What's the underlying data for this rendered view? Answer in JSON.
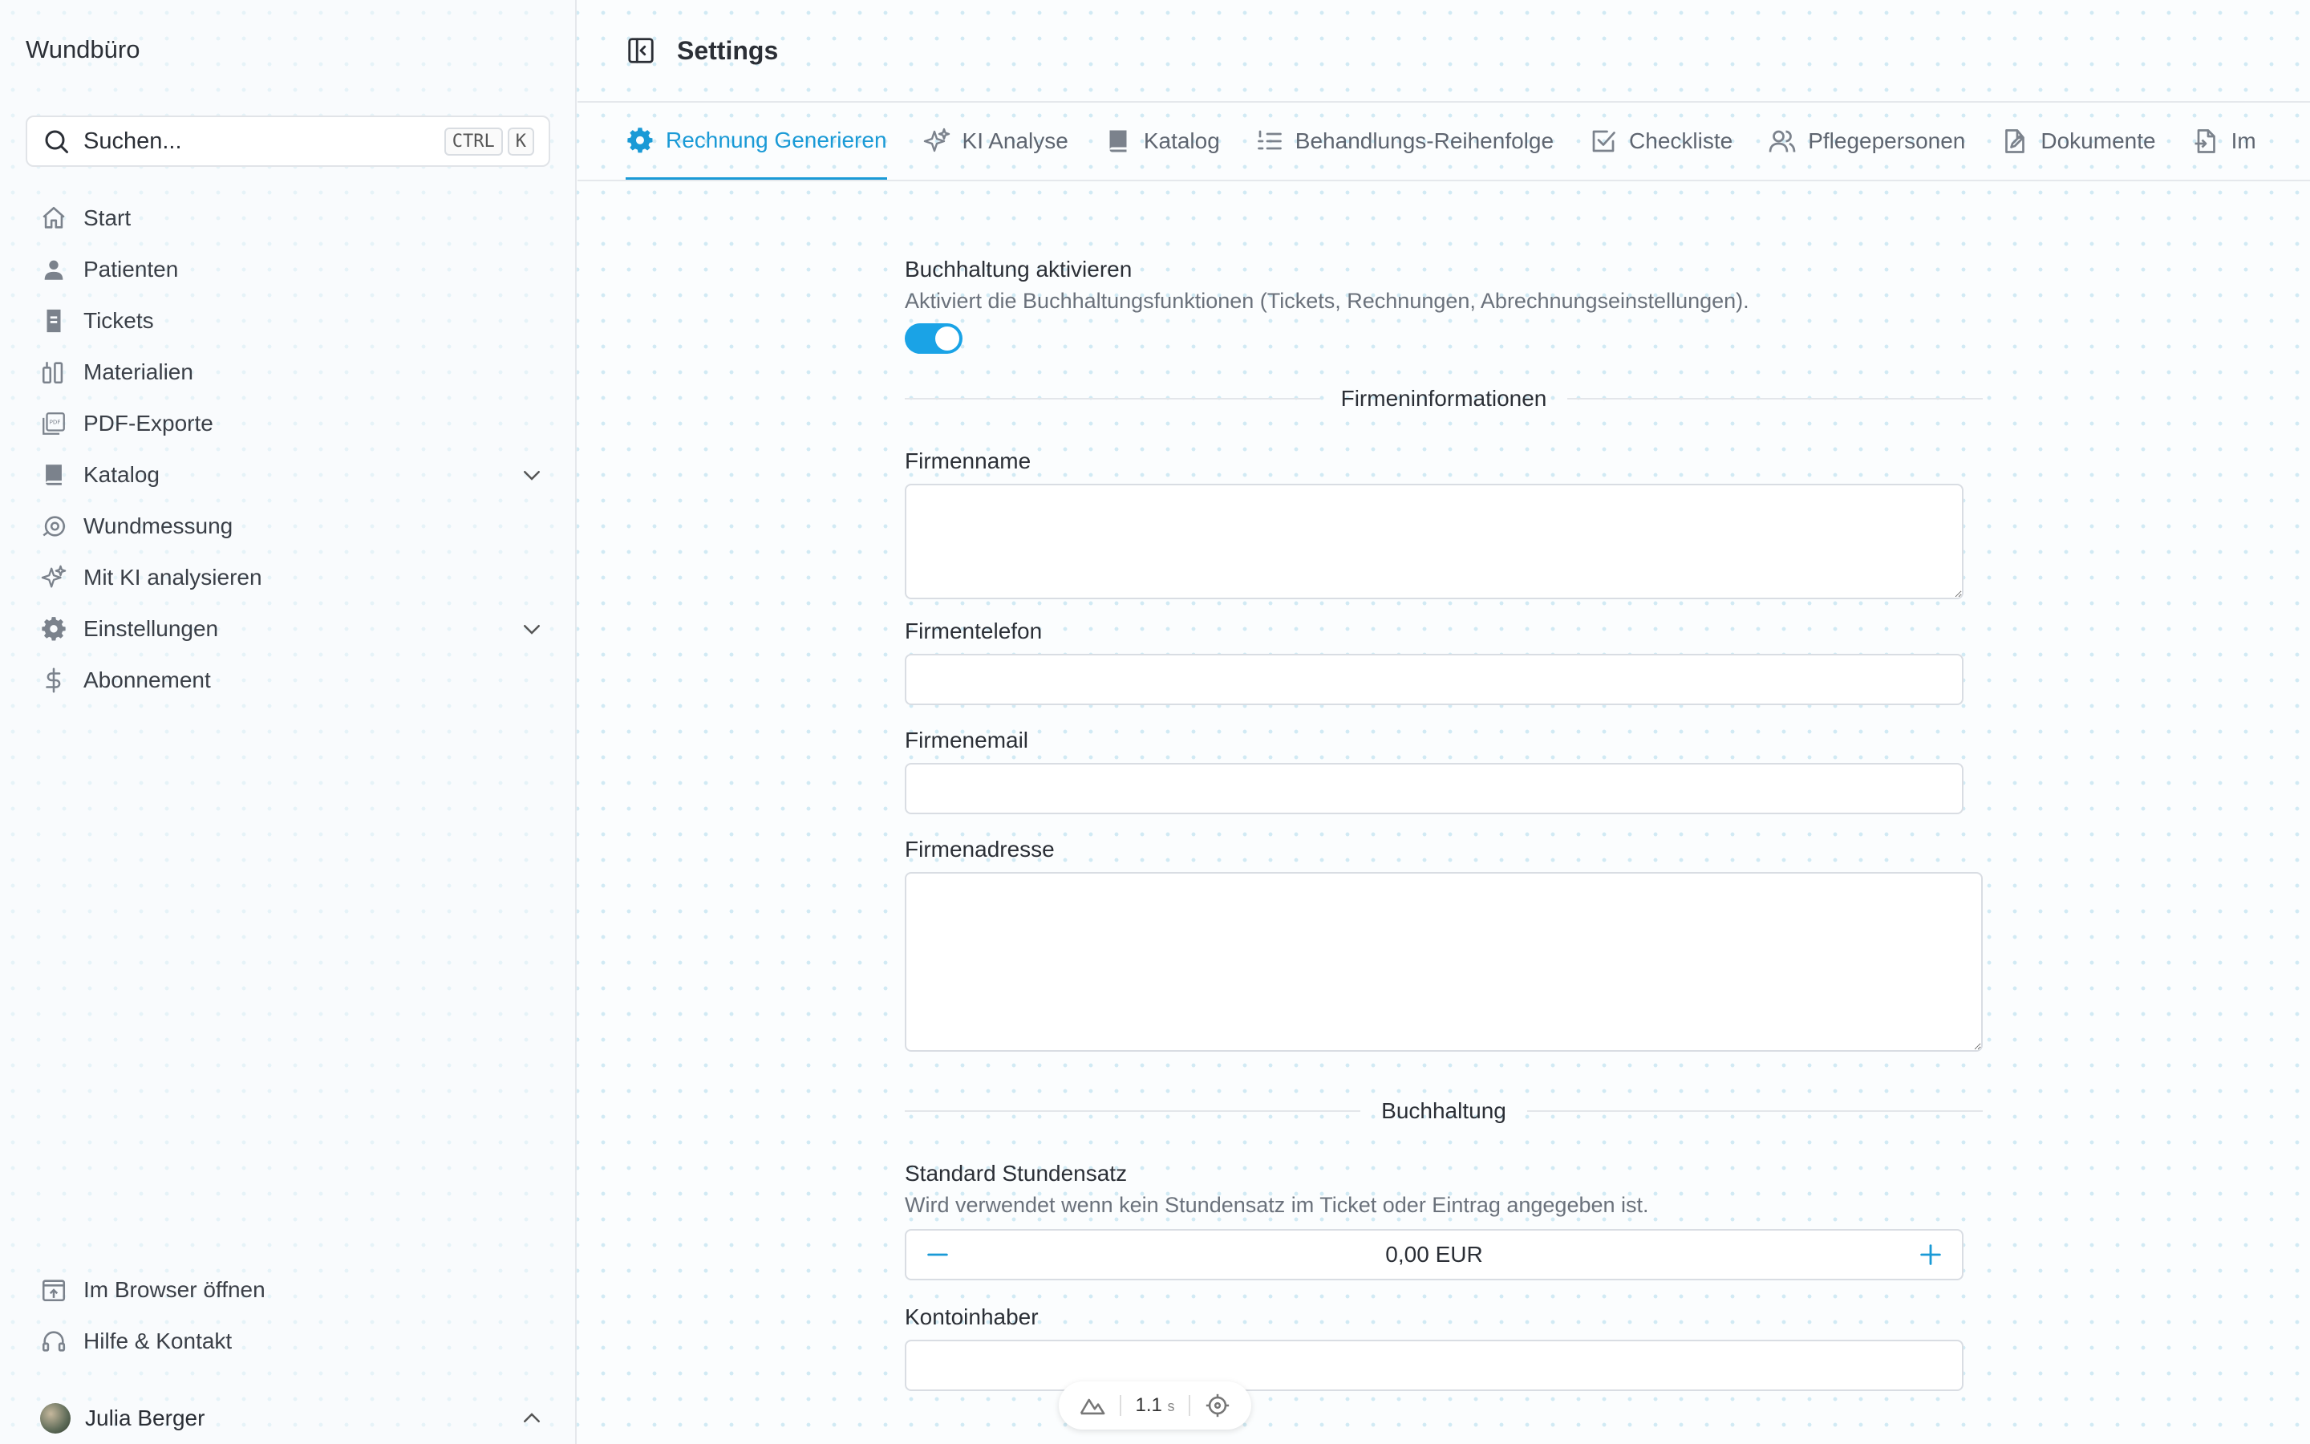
{
  "sidebar": {
    "app_title": "Wundbüro",
    "search": {
      "placeholder": "Suchen...",
      "shortcut": [
        "CTRL",
        "K"
      ]
    },
    "items": [
      {
        "label": "Start",
        "icon": "home-icon"
      },
      {
        "label": "Patienten",
        "icon": "user-icon"
      },
      {
        "label": "Tickets",
        "icon": "ticket-icon"
      },
      {
        "label": "Materialien",
        "icon": "materials-icon"
      },
      {
        "label": "PDF-Exporte",
        "icon": "pdf-icon"
      },
      {
        "label": "Katalog",
        "icon": "book-icon",
        "expandable": true
      },
      {
        "label": "Wundmessung",
        "icon": "measure-icon"
      },
      {
        "label": "Mit KI analysieren",
        "icon": "sparkles-icon"
      },
      {
        "label": "Einstellungen",
        "icon": "gear-icon",
        "expandable": true
      },
      {
        "label": "Abonnement",
        "icon": "dollar-icon"
      }
    ],
    "bottom_items": [
      {
        "label": "Im Browser öffnen",
        "icon": "browser-icon"
      },
      {
        "label": "Hilfe & Kontakt",
        "icon": "headset-icon"
      }
    ],
    "user": {
      "name": "Julia Berger"
    }
  },
  "header": {
    "title": "Settings"
  },
  "tabs": [
    {
      "label": "Rechnung Generieren",
      "icon": "gear-icon",
      "active": true
    },
    {
      "label": "KI Analyse",
      "icon": "sparkles-icon"
    },
    {
      "label": "Katalog",
      "icon": "book-icon"
    },
    {
      "label": "Behandlungs-Reihenfolge",
      "icon": "list-ordered-icon"
    },
    {
      "label": "Checkliste",
      "icon": "checkbox-icon"
    },
    {
      "label": "Pflegepersonen",
      "icon": "users-icon"
    },
    {
      "label": "Dokumente",
      "icon": "document-edit-icon"
    },
    {
      "label": "Im",
      "icon": "import-icon"
    }
  ],
  "form": {
    "accounting": {
      "label": "Buchhaltung aktivieren",
      "description": "Aktiviert die Buchhaltungsfunktionen (Tickets, Rechnungen, Abrechnungseinstellungen).",
      "enabled": true
    },
    "section_company": "Firmeninformationen",
    "company_name": {
      "label": "Firmenname",
      "value": ""
    },
    "company_phone": {
      "label": "Firmentelefon",
      "value": ""
    },
    "company_email": {
      "label": "Firmenemail",
      "value": ""
    },
    "company_address": {
      "label": "Firmenadresse",
      "value": ""
    },
    "section_accounting": "Buchhaltung",
    "hourly_rate": {
      "label": "Standard Stundensatz",
      "description": "Wird verwendet wenn kein Stundensatz im Ticket oder Eintrag angegeben ist.",
      "value": "0,00 EUR"
    },
    "account_holder": {
      "label": "Kontoinhaber",
      "value": ""
    }
  },
  "perf_widget": {
    "value": "1.1",
    "unit": "s"
  },
  "colors": {
    "accent": "#1a9ad6",
    "toggle": "#1aa3e6",
    "border": "#e5e8ec"
  }
}
